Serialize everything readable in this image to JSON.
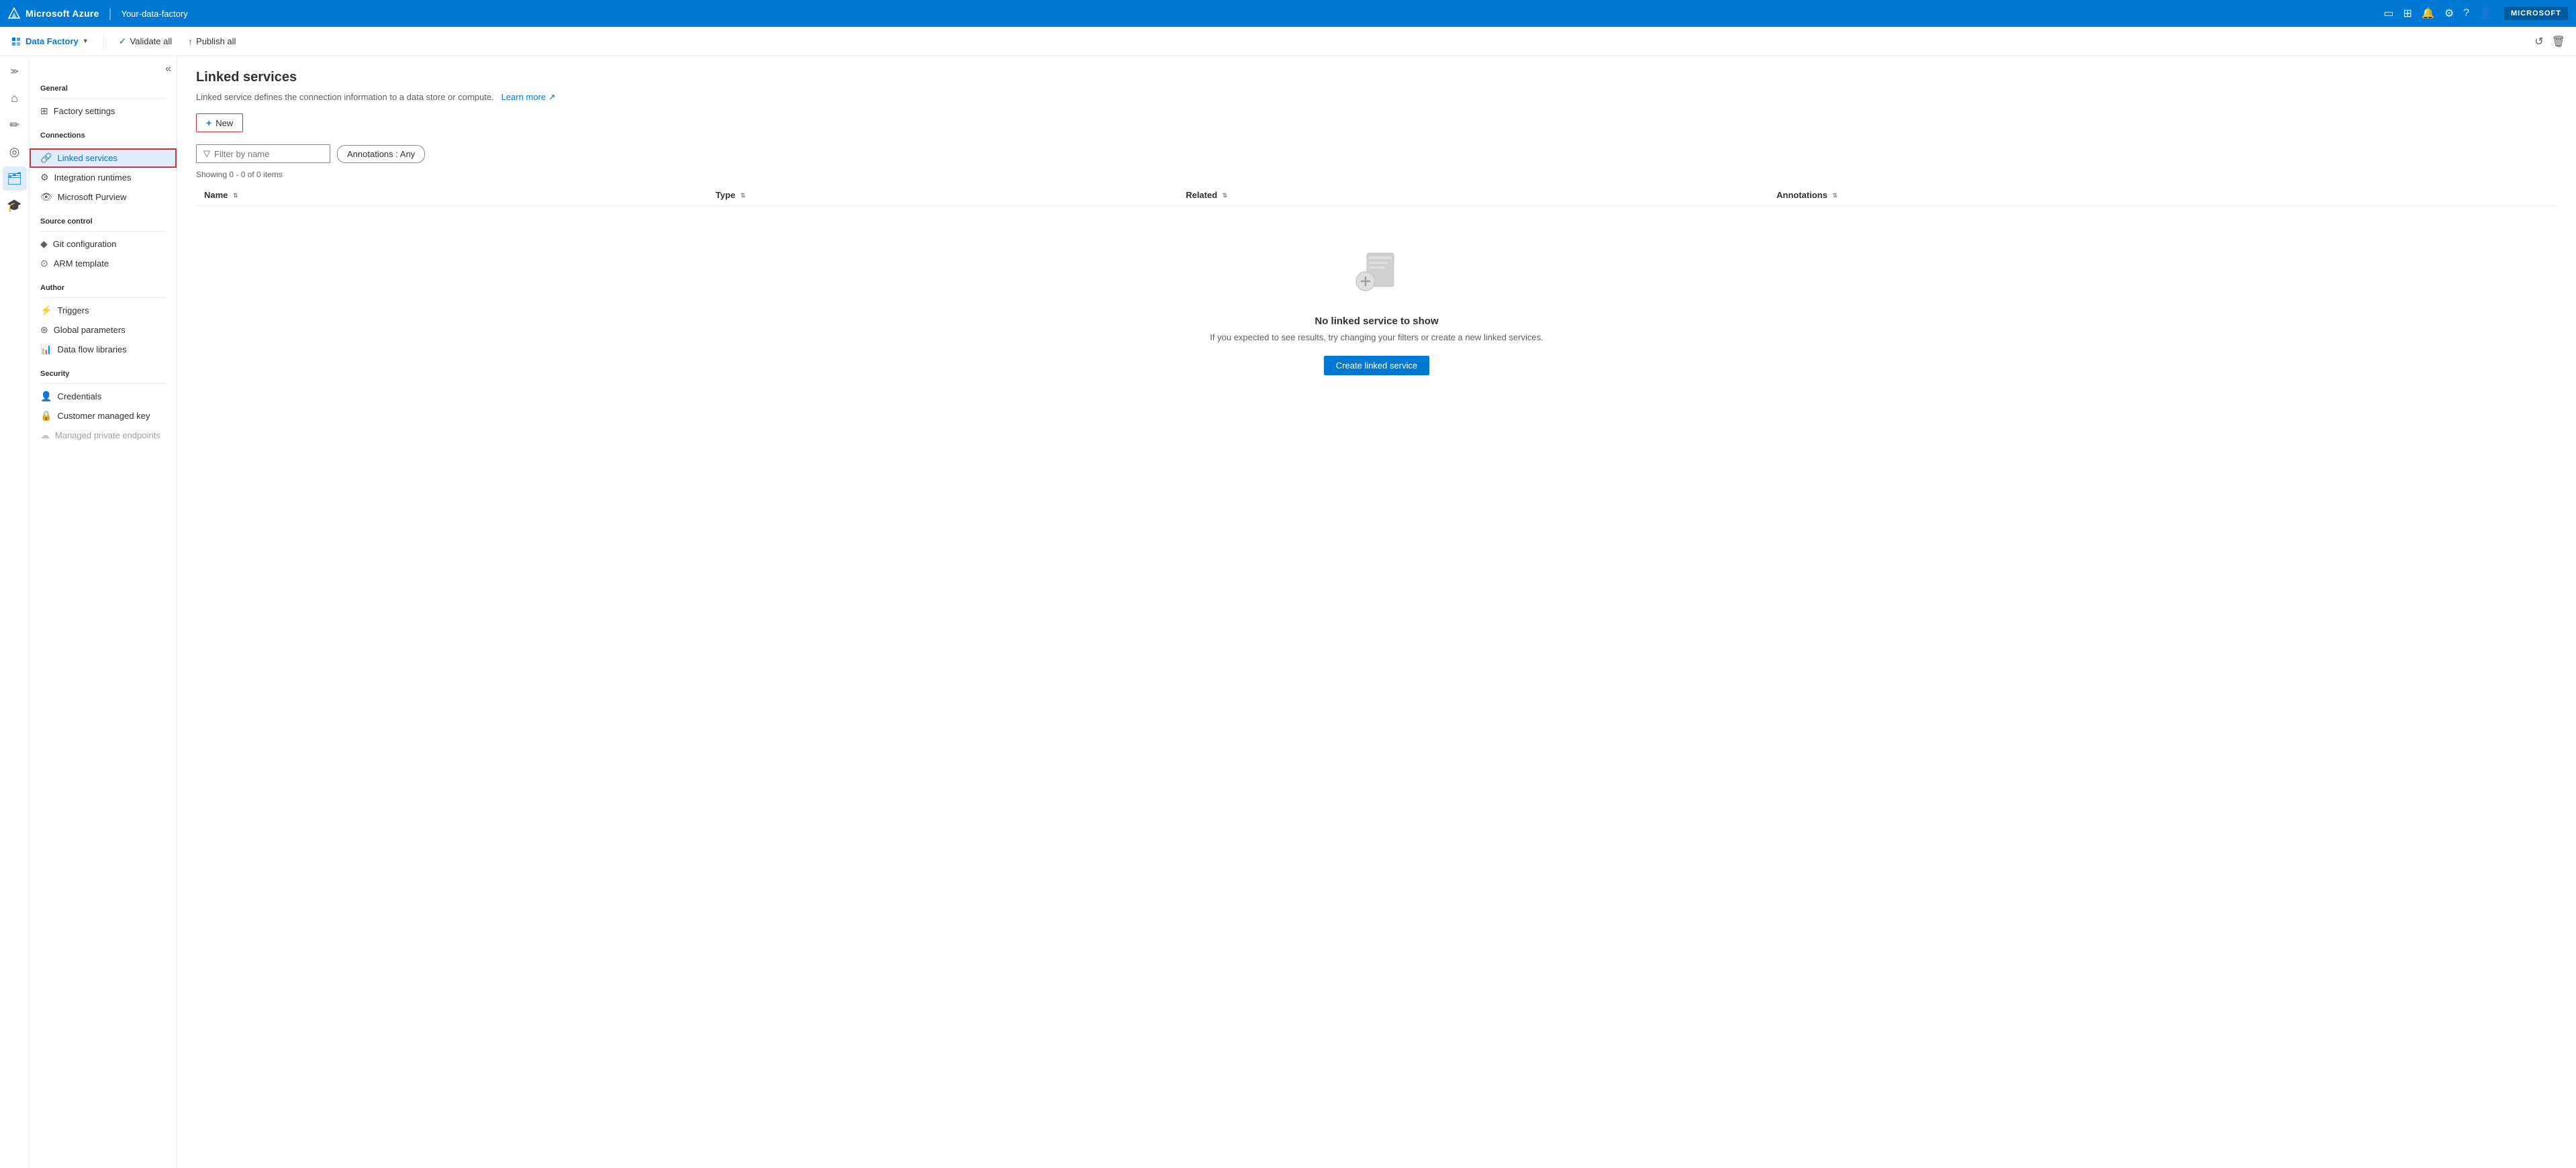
{
  "topNav": {
    "brand": "Microsoft Azure",
    "separator": "|",
    "factoryName": "Your-data-factory",
    "accountLabel": "MICROSOFT",
    "icons": [
      "monitor-icon",
      "grid-icon",
      "bell-icon",
      "gear-icon",
      "question-icon",
      "person-icon"
    ]
  },
  "toolbar": {
    "brandLabel": "Data Factory",
    "validateLabel": "Validate all",
    "publishLabel": "Publish all",
    "refreshIcon": "↺",
    "deleteIcon": "🗑"
  },
  "sidebar": {
    "collapseIcon": "«",
    "sections": [
      {
        "title": "General",
        "items": [
          {
            "id": "factory-settings",
            "label": "Factory settings",
            "icon": "⊞"
          }
        ]
      },
      {
        "title": "Connections",
        "items": [
          {
            "id": "linked-services",
            "label": "Linked services",
            "icon": "🔗",
            "active": true
          },
          {
            "id": "integration-runtimes",
            "label": "Integration runtimes",
            "icon": "⚙"
          },
          {
            "id": "microsoft-purview",
            "label": "Microsoft Purview",
            "icon": "👁"
          }
        ]
      },
      {
        "title": "Source control",
        "items": [
          {
            "id": "git-configuration",
            "label": "Git configuration",
            "icon": "◆"
          },
          {
            "id": "arm-template",
            "label": "ARM template",
            "icon": "⊙"
          }
        ]
      },
      {
        "title": "Author",
        "items": [
          {
            "id": "triggers",
            "label": "Triggers",
            "icon": "⚡"
          },
          {
            "id": "global-parameters",
            "label": "Global parameters",
            "icon": "⊛"
          },
          {
            "id": "data-flow-libraries",
            "label": "Data flow libraries",
            "icon": "📊"
          }
        ]
      },
      {
        "title": "Security",
        "items": [
          {
            "id": "credentials",
            "label": "Credentials",
            "icon": "👤"
          },
          {
            "id": "customer-managed-key",
            "label": "Customer managed key",
            "icon": "🔒"
          },
          {
            "id": "managed-private-endpoints",
            "label": "Managed private endpoints",
            "icon": "☁",
            "disabled": true
          }
        ]
      }
    ]
  },
  "sideIconBar": {
    "icons": [
      {
        "id": "home",
        "symbol": "⌂",
        "active": false
      },
      {
        "id": "edit",
        "symbol": "✏",
        "active": false
      },
      {
        "id": "monitor",
        "symbol": "⊙",
        "active": false
      },
      {
        "id": "manage",
        "symbol": "🗂",
        "active": true
      },
      {
        "id": "learn",
        "symbol": "🎓",
        "active": false
      }
    ]
  },
  "content": {
    "title": "Linked services",
    "description": "Linked service defines the connection information to a data store or compute.",
    "learnMoreLabel": "Learn more",
    "learnMoreIcon": "↗",
    "newButtonLabel": "New",
    "filterPlaceholder": "Filter by name",
    "annotationsLabel": "Annotations : Any",
    "showingText": "Showing 0 - 0 of 0 items",
    "table": {
      "columns": [
        {
          "label": "Name"
        },
        {
          "label": "Type"
        },
        {
          "label": "Related"
        },
        {
          "label": "Annotations"
        }
      ]
    },
    "emptyState": {
      "title": "No linked service to show",
      "description": "If you expected to see results, try changing your filters or create a new linked services.",
      "createButtonLabel": "Create linked service"
    }
  }
}
